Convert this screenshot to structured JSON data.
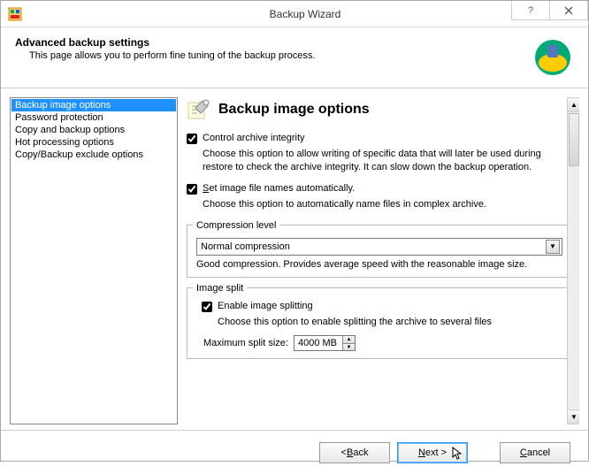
{
  "titlebar": {
    "title": "Backup Wizard"
  },
  "header": {
    "title": "Advanced backup settings",
    "desc": "This page allows you to perform fine tuning of the backup process."
  },
  "sidebar": {
    "items": [
      "Backup image options",
      "Password protection",
      "Copy and backup options",
      "Hot processing options",
      "Copy/Backup exclude options"
    ]
  },
  "section": {
    "title": "Backup image options",
    "integ_label": "Control archive integrity",
    "integ_desc": "Choose this option to allow writing of specific data that will later be used during restore to check the archive integrity. It can slow down the backup operation.",
    "auto_prefix": "S",
    "auto_label_rest": "et image file names automatically.",
    "auto_desc": "Choose this option to automatically name files in complex archive.",
    "compression_legend": "Compression level",
    "compression_value": "Normal compression",
    "compression_hint": "Good compression. Provides average speed with the reasonable image size.",
    "split_legend": "Image split",
    "split_checkbox": "Enable image splitting",
    "split_desc": "Choose this option to enable splitting the archive to several files",
    "split_size_label": "Maximum split size:",
    "split_size_value": "4000 MB"
  },
  "footer": {
    "back_prefix": "< ",
    "back_letter": "B",
    "back_rest": "ack",
    "next_letter": "N",
    "next_rest": "ext >",
    "cancel_letter": "C",
    "cancel_rest": "ancel"
  }
}
